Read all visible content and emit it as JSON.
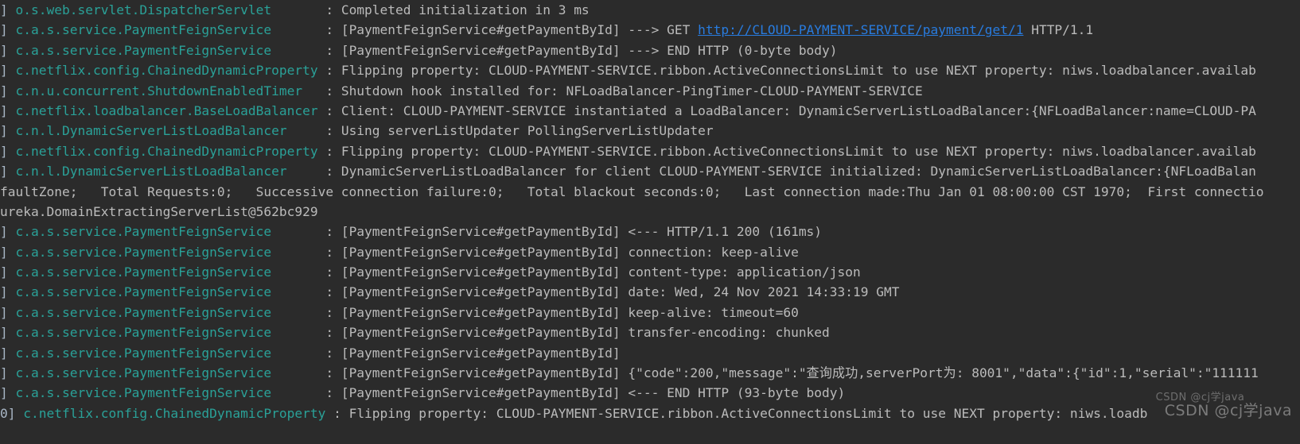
{
  "console": {
    "background_color": "#2b2b2b",
    "logger_color": "#2aa198",
    "message_color": "#bbbbbb",
    "link_color": "#287bde",
    "lines": [
      {
        "thread": "]",
        "logger": " o.s.web.servlet.DispatcherServlet       ",
        "message": ": Completed initialization in 3 ms"
      },
      {
        "thread": "]",
        "logger": " c.a.s.service.PaymentFeignService       ",
        "message": ": [PaymentFeignService#getPaymentById] ---> GET ",
        "link": "http://CLOUD-PAYMENT-SERVICE/payment/get/1",
        "message_after": " HTTP/1.1"
      },
      {
        "thread": "]",
        "logger": " c.a.s.service.PaymentFeignService       ",
        "message": ": [PaymentFeignService#getPaymentById] ---> END HTTP (0-byte body)"
      },
      {
        "thread": "]",
        "logger": " c.netflix.config.ChainedDynamicProperty ",
        "message": ": Flipping property: CLOUD-PAYMENT-SERVICE.ribbon.ActiveConnectionsLimit to use NEXT property: niws.loadbalancer.availab"
      },
      {
        "thread": "]",
        "logger": " c.n.u.concurrent.ShutdownEnabledTimer   ",
        "message": ": Shutdown hook installed for: NFLoadBalancer-PingTimer-CLOUD-PAYMENT-SERVICE"
      },
      {
        "thread": "]",
        "logger": " c.netflix.loadbalancer.BaseLoadBalancer ",
        "message": ": Client: CLOUD-PAYMENT-SERVICE instantiated a LoadBalancer: DynamicServerListLoadBalancer:{NFLoadBalancer:name=CLOUD-PA"
      },
      {
        "thread": "]",
        "logger": " c.n.l.DynamicServerListLoadBalancer     ",
        "message": ": Using serverListUpdater PollingServerListUpdater"
      },
      {
        "thread": "]",
        "logger": " c.netflix.config.ChainedDynamicProperty ",
        "message": ": Flipping property: CLOUD-PAYMENT-SERVICE.ribbon.ActiveConnectionsLimit to use NEXT property: niws.loadbalancer.availab"
      },
      {
        "thread": "]",
        "logger": " c.n.l.DynamicServerListLoadBalancer     ",
        "message": ": DynamicServerListLoadBalancer for client CLOUD-PAYMENT-SERVICE initialized: DynamicServerListLoadBalancer:{NFLoadBalan"
      },
      {
        "continuation": "faultZone;   Total Requests:0;   Successive connection failure:0;   Total blackout seconds:0;   Last connection made:Thu Jan 01 08:00:00 CST 1970;  First connectio"
      },
      {
        "continuation": "ureka.DomainExtractingServerList@562bc929"
      },
      {
        "thread": "]",
        "logger": " c.a.s.service.PaymentFeignService       ",
        "message": ": [PaymentFeignService#getPaymentById] <--- HTTP/1.1 200 (161ms)"
      },
      {
        "thread": "]",
        "logger": " c.a.s.service.PaymentFeignService       ",
        "message": ": [PaymentFeignService#getPaymentById] connection: keep-alive"
      },
      {
        "thread": "]",
        "logger": " c.a.s.service.PaymentFeignService       ",
        "message": ": [PaymentFeignService#getPaymentById] content-type: application/json"
      },
      {
        "thread": "]",
        "logger": " c.a.s.service.PaymentFeignService       ",
        "message": ": [PaymentFeignService#getPaymentById] date: Wed, 24 Nov 2021 14:33:19 GMT"
      },
      {
        "thread": "]",
        "logger": " c.a.s.service.PaymentFeignService       ",
        "message": ": [PaymentFeignService#getPaymentById] keep-alive: timeout=60"
      },
      {
        "thread": "]",
        "logger": " c.a.s.service.PaymentFeignService       ",
        "message": ": [PaymentFeignService#getPaymentById] transfer-encoding: chunked"
      },
      {
        "thread": "]",
        "logger": " c.a.s.service.PaymentFeignService       ",
        "message": ": [PaymentFeignService#getPaymentById]"
      },
      {
        "thread": "]",
        "logger": " c.a.s.service.PaymentFeignService       ",
        "message": ": [PaymentFeignService#getPaymentById] {\"code\":200,\"message\":\"查询成功,serverPort为: 8001\",\"data\":{\"id\":1,\"serial\":\"111111"
      },
      {
        "thread": "]",
        "logger": " c.a.s.service.PaymentFeignService       ",
        "message": ": [PaymentFeignService#getPaymentById] <--- END HTTP (93-byte body)"
      },
      {
        "thread": "0]",
        "logger": " c.netflix.config.ChainedDynamicProperty ",
        "message": ": Flipping property: CLOUD-PAYMENT-SERVICE.ribbon.ActiveConnectionsLimit to use NEXT property: niws.loadb"
      }
    ]
  },
  "watermark": {
    "primary": "CSDN @cj学java",
    "secondary": "CSDN @cj学java"
  }
}
